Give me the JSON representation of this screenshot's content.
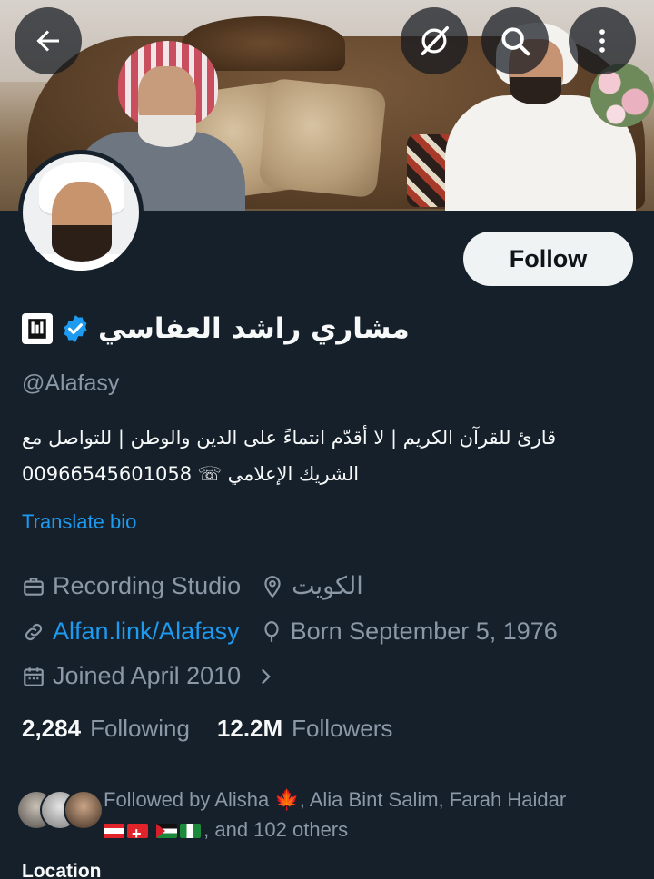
{
  "header": {
    "back_icon": "arrow-left-icon",
    "grok_icon": "grok-icon",
    "search_icon": "search-icon",
    "more_icon": "more-vertical-icon"
  },
  "profile": {
    "display_name": "مشاري راشد العفاسي",
    "handle": "@Alafasy",
    "follow_label": "Follow",
    "bio_line1": "قارئ للقرآن الكريم | لا أقدّم انتماءً على الدين والوطن | للتواصل مع",
    "bio_line2": "الشريك الإعلامي ☏ 00966545601058",
    "translate_label": "Translate bio",
    "category": "Recording Studio",
    "location": "الكويت",
    "website": "Alfan.link/Alafasy",
    "born": "Born September 5, 1976",
    "joined": "Joined April 2010",
    "following_count": "2,284",
    "following_label": "Following",
    "followers_count": "12.2M",
    "followers_label": "Followers",
    "followed_by_prefix": "Followed by Alisha 🍁, Alia Bint Salim, Farah Haidar",
    "followed_by_suffix": ", and 102 others",
    "section_label": "Location"
  },
  "colors": {
    "background": "#15202b",
    "accent": "#1d9bf0",
    "secondary_text": "#8b98a5",
    "primary_text": "#f7f9f9"
  }
}
